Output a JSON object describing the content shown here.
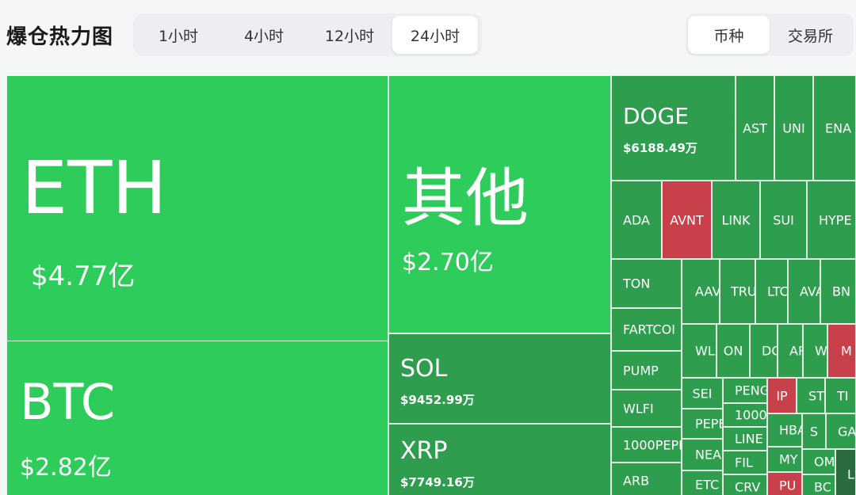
{
  "header": {
    "title": "爆仓热力图",
    "time_tabs": [
      {
        "label": "1小时",
        "active": false
      },
      {
        "label": "4小时",
        "active": false
      },
      {
        "label": "12小时",
        "active": false
      },
      {
        "label": "24小时",
        "active": true
      }
    ],
    "type_tabs": [
      {
        "label": "币种",
        "active": true
      },
      {
        "label": "交易所",
        "active": false
      }
    ]
  },
  "colors": {
    "long_bright": "#2ecc5a",
    "long_dark": "#2e9e4e",
    "short_red": "#c8414a"
  },
  "tiles": {
    "eth": {
      "symbol": "ETH",
      "value": "$4.77亿"
    },
    "btc": {
      "symbol": "BTC",
      "value": "$2.82亿"
    },
    "other": {
      "symbol": "其他",
      "value": "$2.70亿"
    },
    "sol": {
      "symbol": "SOL",
      "value": "$9452.99万"
    },
    "xrp": {
      "symbol": "XRP",
      "value": "$7749.16万"
    },
    "doge": {
      "symbol": "DOGE",
      "value": "$6188.49万"
    },
    "ast": {
      "symbol": "AST"
    },
    "uni": {
      "symbol": "UNI"
    },
    "ena": {
      "symbol": "ENA"
    },
    "ada": {
      "symbol": "ADA"
    },
    "avnt": {
      "symbol": "AVNT"
    },
    "link": {
      "symbol": "LINK"
    },
    "sui": {
      "symbol": "SUI"
    },
    "hype": {
      "symbol": "HYPE"
    },
    "ton": {
      "symbol": "TON"
    },
    "fartcoin": {
      "symbol": "FARTCOI"
    },
    "pump": {
      "symbol": "PUMP"
    },
    "wlfi": {
      "symbol": "WLFI"
    },
    "pepe1000": {
      "symbol": "1000PEPI"
    },
    "arb": {
      "symbol": "ARB"
    },
    "aave": {
      "symbol": "AAV"
    },
    "tru": {
      "symbol": "TRU"
    },
    "ltc": {
      "symbol": "LTC"
    },
    "ava": {
      "symbol": "AVA"
    },
    "bn": {
      "symbol": "BN"
    },
    "wl": {
      "symbol": "WL"
    },
    "on": {
      "symbol": "ON"
    },
    "do": {
      "symbol": "DO"
    },
    "ar": {
      "symbol": "AR"
    },
    "w": {
      "symbol": "W"
    },
    "m": {
      "symbol": "M"
    },
    "sei": {
      "symbol": "SEI"
    },
    "peng": {
      "symbol": "PENG"
    },
    "ip": {
      "symbol": "IP"
    },
    "st": {
      "symbol": "ST"
    },
    "ti": {
      "symbol": "TI"
    },
    "pepe": {
      "symbol": "PEPE"
    },
    "k1000": {
      "symbol": "1000"
    },
    "hba": {
      "symbol": "HBA"
    },
    "s": {
      "symbol": "S"
    },
    "ga": {
      "symbol": "GA"
    },
    "near": {
      "symbol": "NEA"
    },
    "line": {
      "symbol": "LINE"
    },
    "my": {
      "symbol": "MY"
    },
    "fil": {
      "symbol": "FIL"
    },
    "om": {
      "symbol": "OM"
    },
    "l": {
      "symbol": "L"
    },
    "etc": {
      "symbol": "ETC"
    },
    "crv": {
      "symbol": "CRV"
    },
    "pu": {
      "symbol": "PU"
    },
    "bc": {
      "symbol": "BC"
    }
  }
}
